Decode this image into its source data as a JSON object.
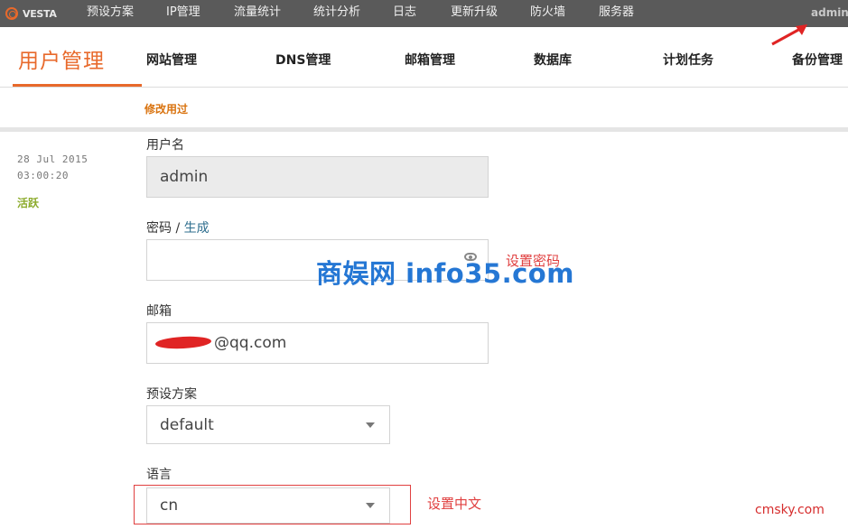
{
  "header": {
    "logo": "VESTA",
    "nav": [
      {
        "label": "预设方案"
      },
      {
        "label": "IP管理"
      },
      {
        "label": "流量统计"
      },
      {
        "label": "统计分析"
      },
      {
        "label": "日志"
      },
      {
        "label": "更新升级"
      },
      {
        "label": "防火墙"
      },
      {
        "label": "服务器"
      }
    ],
    "user": "admin"
  },
  "section": {
    "title": "用户管理",
    "tabs": [
      {
        "label": "网站管理"
      },
      {
        "label": "DNS管理"
      },
      {
        "label": "邮箱管理"
      },
      {
        "label": "数据库"
      },
      {
        "label": "计划任务"
      },
      {
        "label": "备份管理"
      }
    ],
    "action": "修改用过"
  },
  "meta": {
    "date": "28 Jul 2015",
    "time": "03:00:20",
    "status": "活跃"
  },
  "form": {
    "username_label": "用户名",
    "username_value": "admin",
    "password_label": "密码",
    "password_sep": " / ",
    "password_generate": "生成",
    "email_label": "邮箱",
    "email_value": "@qq.com",
    "package_label": "预设方案",
    "package_value": "default",
    "language_label": "语言",
    "language_value": "cn"
  },
  "annotations": {
    "password_note": "设置密码",
    "language_note": "设置中文",
    "watermark": "商娱网 info35.com",
    "corner": "cmsky.com"
  },
  "colors": {
    "accent": "#e8692b",
    "topbar": "#5a5a5a",
    "active_status": "#8cab2c",
    "annotation_red": "#e04040",
    "watermark_blue": "#2577d4"
  }
}
